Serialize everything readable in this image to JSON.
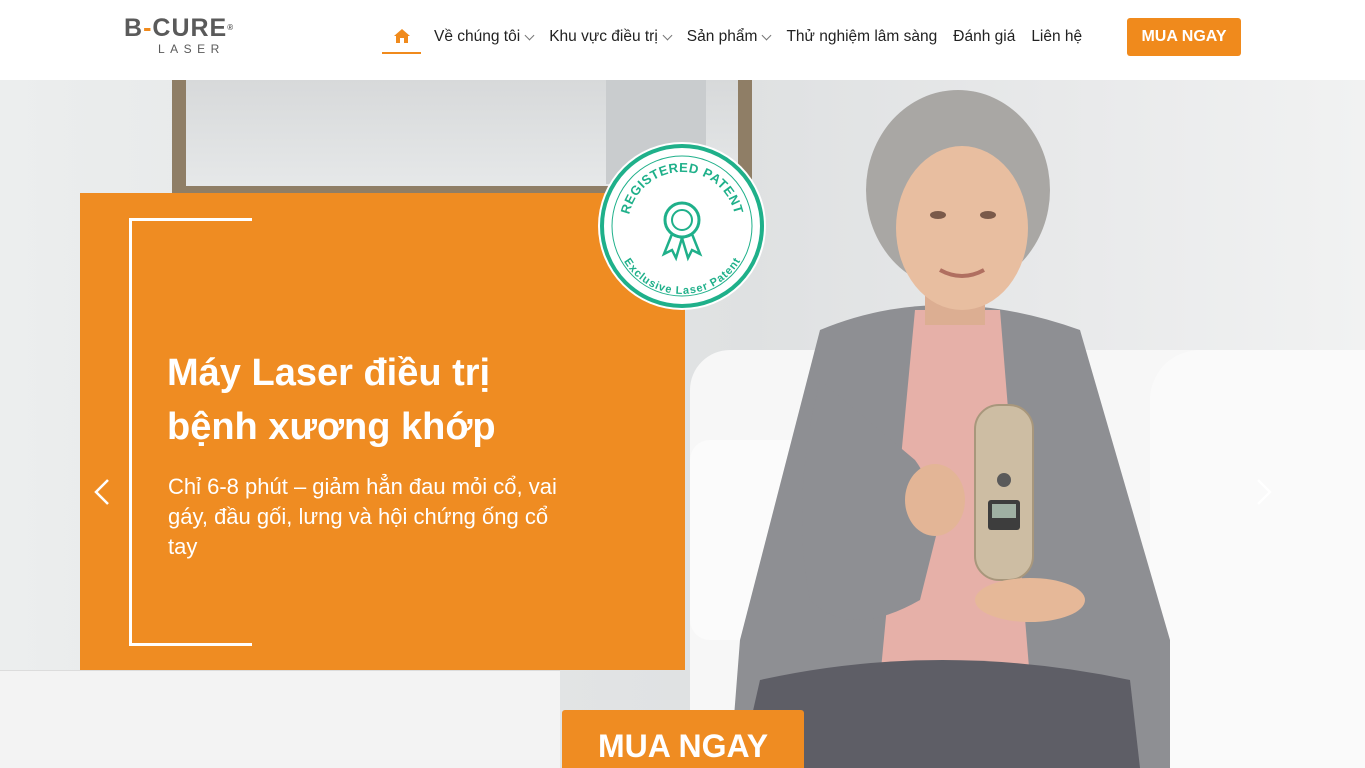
{
  "brand": {
    "logo_main": "B-CURE",
    "logo_sub": "LASER",
    "accent_color": "#f08a1c"
  },
  "nav": {
    "home_icon": "home-icon",
    "items": [
      {
        "label": "Về chúng tôi",
        "has_dropdown": true
      },
      {
        "label": "Khu vực điều trị",
        "has_dropdown": true
      },
      {
        "label": "Sản phẩm",
        "has_dropdown": true
      },
      {
        "label": "Thử nghiệm lâm sàng",
        "has_dropdown": false
      },
      {
        "label": "Đánh giá",
        "has_dropdown": false
      },
      {
        "label": "Liên hệ",
        "has_dropdown": false
      }
    ],
    "cta_label": "MUA NGAY"
  },
  "hero": {
    "title_line1": "Máy Laser điều trị",
    "title_line2": "bệnh xương khớp",
    "subtitle": "Chỉ 6-8 phút – giảm hẳn đau mỏi cổ, vai gáy, đầu gối, lưng và hội chứng ống cổ tay",
    "badge_top": "REGISTERED PATENT",
    "badge_bottom": "Exclusive Laser Patent",
    "badge_color": "#1fb08a",
    "cta_label": "MUA NGAY",
    "prev_icon": "chevron-left-icon",
    "next_icon": "chevron-right-icon"
  }
}
